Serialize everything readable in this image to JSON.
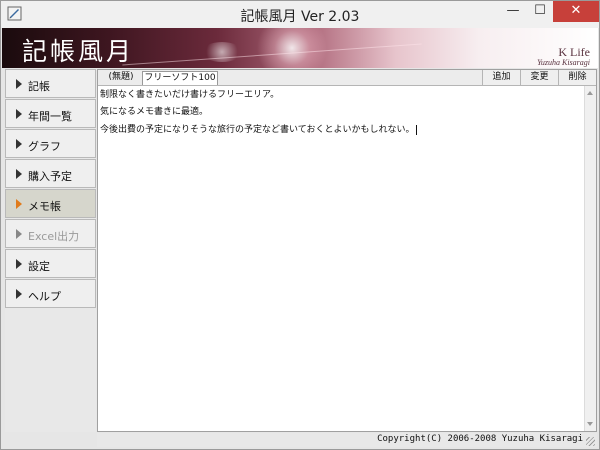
{
  "window": {
    "title": "記帳風月 Ver 2.03",
    "close_glyph": "✕",
    "minimize_glyph": "—",
    "maximize_glyph": "☐"
  },
  "banner": {
    "title": "記帳風月",
    "brand_name": "K Life",
    "brand_author": "Yuzuha Kisaragi"
  },
  "sidebar": {
    "items": [
      {
        "label": "記帳"
      },
      {
        "label": "年間一覧"
      },
      {
        "label": "グラフ"
      },
      {
        "label": "購入予定"
      },
      {
        "label": "メモ帳",
        "active": true
      },
      {
        "label": "Excel出力",
        "disabled": true
      },
      {
        "label": "設定"
      },
      {
        "label": "ヘルプ"
      }
    ]
  },
  "memo": {
    "tabs": [
      {
        "label": "(無題)"
      },
      {
        "label": "フリーソフト100",
        "selected": true
      }
    ],
    "actions": {
      "add": "追加",
      "edit": "変更",
      "delete": "削除"
    },
    "lines": [
      "制限なく書きたいだけ書けるフリーエリア。",
      "気になるメモ書きに最適。",
      "今後出費の予定になりそうな旅行の予定など書いておくとよいかもしれない。"
    ]
  },
  "status": {
    "copyright": "Copyright(C) 2006-2008 Yuzuha Kisaragi"
  },
  "colors": {
    "close_button": "#c7403a",
    "active_arrow": "#e07b1c",
    "banner_dark": "#1a0b0d",
    "brand_text": "#5a3340"
  }
}
